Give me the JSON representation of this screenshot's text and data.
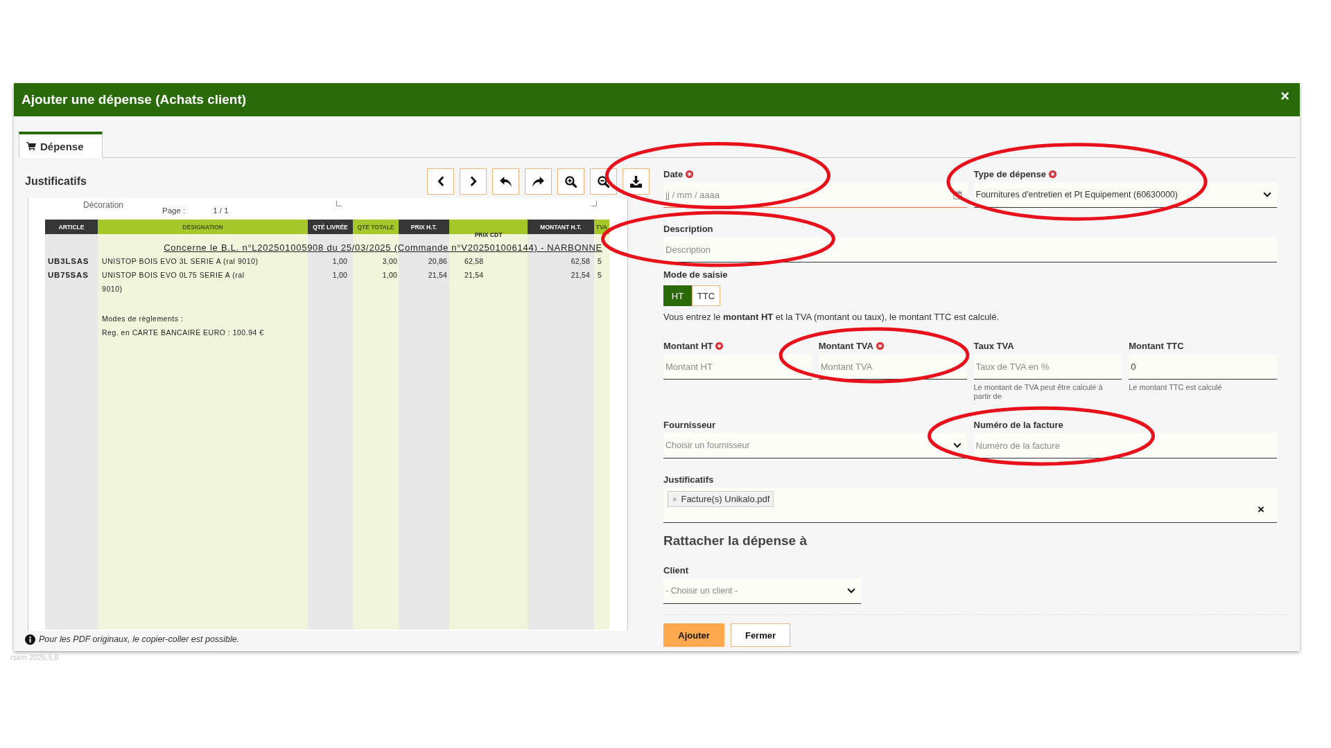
{
  "window": {
    "title": "Ajouter une dépense (Achats client)",
    "close": "×"
  },
  "tabs": [
    {
      "label": "Dépense",
      "selected": true
    }
  ],
  "documents": {
    "title": "Justificatifs",
    "viewer": {
      "header_text": "Décoration",
      "page_label": "Page :",
      "page_number": "1 / 1",
      "columns": [
        "ARTICLE",
        "DÉSIGNATION",
        "QTÉ LIVRÉE",
        "QTÉ TOTALE",
        "PRIX H.T.",
        "PRIX CDT",
        "MONTANT H.T.",
        "TVA"
      ],
      "reference": "Concerne le B.L. n°L202501005908 du 25/03/2025 (Commande n°V202501006144) - NARBONNE",
      "rows": [
        [
          "UB3LSAS",
          "UNISTOP BOIS EVO 3L SERIE A (ral 9010)",
          "1,00",
          "3,00",
          "20,86",
          "62,58",
          "62,58",
          "5"
        ],
        [
          "UB75SAS",
          "UNISTOP BOIS EVO 0L75 SERIE A (ral 9010)",
          "1,00",
          "1,00",
          "21,54",
          "21,54",
          "21,54",
          "5"
        ]
      ],
      "payment_title": "Modes de règlements :",
      "payment": "Reg. en CARTE BANCAIRE EURO : 100.94 €"
    },
    "note": "Pour les PDF originaux, le copier-coller est possible."
  },
  "form": {
    "rows": [
      {
        "fields": [
          {
            "kind": "date",
            "label": "Date",
            "required": true,
            "placeholder": "jj / mm / aaaa",
            "focused": true,
            "circled": true
          },
          {
            "kind": "select",
            "label": "Type de dépense",
            "required": true,
            "value": "Fournitures d'entretien et Pt Equipement (60630000)",
            "focused": false,
            "circled": true
          }
        ]
      },
      {
        "fields": [
          {
            "kind": "text",
            "label": "Description",
            "required": false,
            "placeholder": "Description",
            "focused": false,
            "circled": true
          }
        ]
      },
      {
        "fields": [
          {
            "kind": "toggle",
            "label": "Mode de saisie",
            "required": false,
            "options": [
              {
                "label": "HT",
                "selected": true
              },
              {
                "label": "TTC",
                "selected": false
              }
            ],
            "help": "Vous entrez le **montant HT** et la TVA (montant ou taux), le montant TTC est calculé.",
            "circled": false
          }
        ]
      },
      {
        "fields": [
          {
            "kind": "text",
            "label": "Montant HT",
            "required": true,
            "placeholder": "Montant HT",
            "focused": false,
            "circled": false
          },
          {
            "kind": "text",
            "label": "Montant TVA",
            "required": true,
            "placeholder": "Montant TVA",
            "focused": false,
            "circled": true
          },
          {
            "kind": "text",
            "label": "Taux TVA",
            "required": false,
            "placeholder": "Taux de TVA en %",
            "hint": "Le montant de TVA peut être calculé à partir de",
            "focused": false,
            "circled": false
          },
          {
            "kind": "text",
            "label": "Montant TTC",
            "required": false,
            "value": "0",
            "hint": "Le montant TTC est calculé",
            "focused": false,
            "circled": false
          }
        ]
      },
      {
        "fields": [
          {
            "kind": "select",
            "label": "Fournisseur",
            "required": false,
            "placeholder": "Choisir un fournisseur",
            "focused": false,
            "circled": false
          },
          {
            "kind": "text",
            "label": "Numéro de la facture",
            "required": false,
            "placeholder": "Numéro de la facture",
            "focused": false,
            "circled": true
          }
        ]
      },
      {
        "fields": [
          {
            "kind": "files",
            "label": "Justificatifs",
            "required": false,
            "files": [
              {
                "name": "Facture(s) Unikalo.pdf",
                "remove": "×"
              }
            ],
            "clear": "×",
            "focused": false,
            "circled": false
          }
        ]
      }
    ],
    "section_title": "Rattacher la dépense à",
    "client": {
      "kind": "select",
      "label": "Client",
      "required": false,
      "placeholder": "- Choisir un client -",
      "focused": false,
      "circled": false
    },
    "buttons": [
      {
        "label": "Ajouter",
        "primary": true
      },
      {
        "label": "Fermer",
        "primary": false
      }
    ]
  },
  "footer_text": "rsion 2025.5.8"
}
